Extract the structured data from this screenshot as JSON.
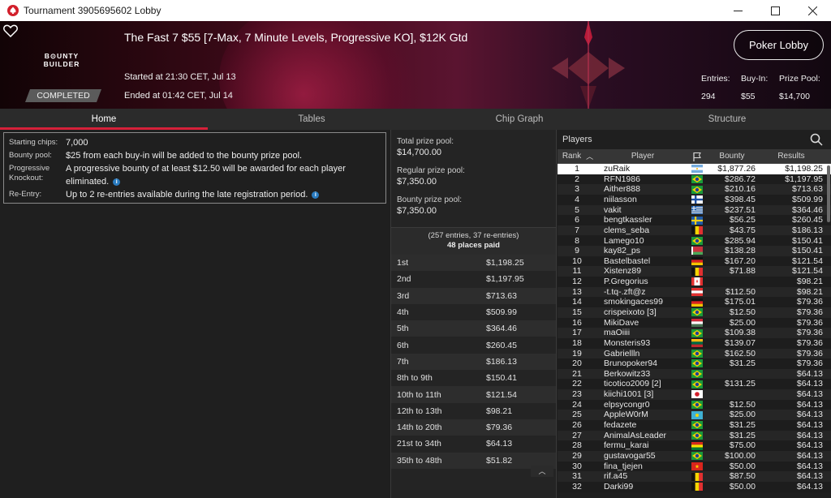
{
  "window": {
    "title": "Tournament 3905695602 Lobby"
  },
  "banner": {
    "title": "The Fast 7 $55 [7-Max, 7 Minute Levels, Progressive KO], $12K Gtd",
    "logo_line1": "B⊙UNTY",
    "logo_line2": "BUILDER",
    "status": "COMPLETED",
    "started": "Started at 21:30 CET, Jul 13",
    "ended": "Ended at 01:42 CET, Jul 14",
    "lobby_button": "Poker Lobby",
    "entries_label": "Entries:",
    "buyin_label": "Buy-In:",
    "prizepool_label": "Prize Pool:",
    "entries": "294",
    "buyin": "$55",
    "prizepool": "$14,700"
  },
  "tabs": [
    "Home",
    "Tables",
    "Chip Graph",
    "Structure"
  ],
  "info": {
    "starting_chips_label": "Starting chips:",
    "starting_chips": "7,000",
    "bounty_pool_label": "Bounty pool:",
    "bounty_pool": "$25 from each buy-in will be added to the bounty prize pool.",
    "pko_label": "Progressive Knockout:",
    "pko": "A progressive bounty of at least $12.50 will be awarded for each player eliminated.",
    "reentry_label": "Re-Entry:",
    "reentry": "Up to 2 re-entries available during the late registration period."
  },
  "prizes": {
    "total_label": "Total prize pool:",
    "total": "$14,700.00",
    "regular_label": "Regular prize pool:",
    "regular": "$7,350.00",
    "bounty_label": "Bounty prize pool:",
    "bounty": "$7,350.00",
    "entries_note": "(257 entries, 37 re-entries)",
    "places_paid": "48 places paid",
    "payouts": [
      {
        "place": "1st",
        "amount": "$1,198.25"
      },
      {
        "place": "2nd",
        "amount": "$1,197.95"
      },
      {
        "place": "3rd",
        "amount": "$713.63"
      },
      {
        "place": "4th",
        "amount": "$509.99"
      },
      {
        "place": "5th",
        "amount": "$364.46"
      },
      {
        "place": "6th",
        "amount": "$260.45"
      },
      {
        "place": "7th",
        "amount": "$186.13"
      },
      {
        "place": "8th to 9th",
        "amount": "$150.41"
      },
      {
        "place": "10th to 11th",
        "amount": "$121.54"
      },
      {
        "place": "12th to 13th",
        "amount": "$98.21"
      },
      {
        "place": "14th to 20th",
        "amount": "$79.36"
      },
      {
        "place": "21st to 34th",
        "amount": "$64.13"
      },
      {
        "place": "35th to 48th",
        "amount": "$51.82"
      }
    ]
  },
  "players": {
    "title": "Players",
    "columns": {
      "rank": "Rank",
      "player": "Player",
      "bounty": "Bounty",
      "results": "Results"
    },
    "rows": [
      {
        "rank": "1",
        "name": "zuRaik",
        "flag": "ar",
        "bounty": "$1,877.26",
        "result": "$1,198.25"
      },
      {
        "rank": "2",
        "name": "RFN1986",
        "flag": "br",
        "bounty": "$286.72",
        "result": "$1,197.95"
      },
      {
        "rank": "3",
        "name": "Aither888",
        "flag": "br",
        "bounty": "$210.16",
        "result": "$713.63"
      },
      {
        "rank": "4",
        "name": "niilasson",
        "flag": "fi",
        "bounty": "$398.45",
        "result": "$509.99"
      },
      {
        "rank": "5",
        "name": "vakit",
        "flag": "gr",
        "bounty": "$237.51",
        "result": "$364.46"
      },
      {
        "rank": "6",
        "name": "bengtkassler",
        "flag": "se",
        "bounty": "$56.25",
        "result": "$260.45"
      },
      {
        "rank": "7",
        "name": "clems_seba",
        "flag": "be",
        "bounty": "$43.75",
        "result": "$186.13"
      },
      {
        "rank": "8",
        "name": "Lamego10",
        "flag": "br",
        "bounty": "$285.94",
        "result": "$150.41"
      },
      {
        "rank": "9",
        "name": "kay82_ps",
        "flag": "by",
        "bounty": "$138.28",
        "result": "$150.41"
      },
      {
        "rank": "10",
        "name": "Bastelbastel",
        "flag": "de",
        "bounty": "$167.20",
        "result": "$121.54"
      },
      {
        "rank": "11",
        "name": "Xistenz89",
        "flag": "be",
        "bounty": "$71.88",
        "result": "$121.54"
      },
      {
        "rank": "12",
        "name": "P.Gregorius",
        "flag": "ca",
        "bounty": "",
        "result": "$98.21"
      },
      {
        "rank": "13",
        "name": "-t.tq-.zft@z",
        "flag": "at",
        "bounty": "$112.50",
        "result": "$98.21"
      },
      {
        "rank": "14",
        "name": "smokingaces99",
        "flag": "de",
        "bounty": "$175.01",
        "result": "$79.36"
      },
      {
        "rank": "15",
        "name": "crispeixoto [3]",
        "flag": "br",
        "bounty": "$12.50",
        "result": "$79.36"
      },
      {
        "rank": "16",
        "name": "MikiDave",
        "flag": "hu",
        "bounty": "$25.00",
        "result": "$79.36"
      },
      {
        "rank": "17",
        "name": "maOiiii",
        "flag": "br",
        "bounty": "$109.38",
        "result": "$79.36"
      },
      {
        "rank": "18",
        "name": "Monsteris93",
        "flag": "lt",
        "bounty": "$139.07",
        "result": "$79.36"
      },
      {
        "rank": "19",
        "name": "Gabriellln",
        "flag": "br",
        "bounty": "$162.50",
        "result": "$79.36"
      },
      {
        "rank": "20",
        "name": "Brunopoker94",
        "flag": "br",
        "bounty": "$31.25",
        "result": "$79.36"
      },
      {
        "rank": "21",
        "name": "Berkowitz33",
        "flag": "br",
        "bounty": "",
        "result": "$64.13"
      },
      {
        "rank": "22",
        "name": "ticotico2009 [2]",
        "flag": "br",
        "bounty": "$131.25",
        "result": "$64.13"
      },
      {
        "rank": "23",
        "name": "kiichi1001 [3]",
        "flag": "jp",
        "bounty": "",
        "result": "$64.13"
      },
      {
        "rank": "24",
        "name": "elpsycongr0",
        "flag": "br",
        "bounty": "$12.50",
        "result": "$64.13"
      },
      {
        "rank": "25",
        "name": "AppleW0rM",
        "flag": "kz",
        "bounty": "$25.00",
        "result": "$64.13"
      },
      {
        "rank": "26",
        "name": "fedazete",
        "flag": "br",
        "bounty": "$31.25",
        "result": "$64.13"
      },
      {
        "rank": "27",
        "name": "AnimalAsLeader",
        "flag": "br",
        "bounty": "$31.25",
        "result": "$64.13"
      },
      {
        "rank": "28",
        "name": "fermu_karai",
        "flag": "bo",
        "bounty": "$75.00",
        "result": "$64.13"
      },
      {
        "rank": "29",
        "name": "gustavogar55",
        "flag": "br",
        "bounty": "$100.00",
        "result": "$64.13"
      },
      {
        "rank": "30",
        "name": "fina_tjejen",
        "flag": "vn",
        "bounty": "$50.00",
        "result": "$64.13"
      },
      {
        "rank": "31",
        "name": "rif.a45",
        "flag": "be",
        "bounty": "$87.50",
        "result": "$64.13"
      },
      {
        "rank": "32",
        "name": "Darki99",
        "flag": "be",
        "bounty": "$50.00",
        "result": "$64.13"
      }
    ]
  },
  "colors": {
    "accent": "#d6203a",
    "info_icon": "#2a7bbf",
    "banner_dark": "#2a0710"
  },
  "icons": {
    "app": "pokerstars-spade-icon",
    "heart": "heart-icon",
    "search": "search-icon",
    "sort": "chevron-up-icon",
    "scroll": "chevron-up-icon"
  }
}
